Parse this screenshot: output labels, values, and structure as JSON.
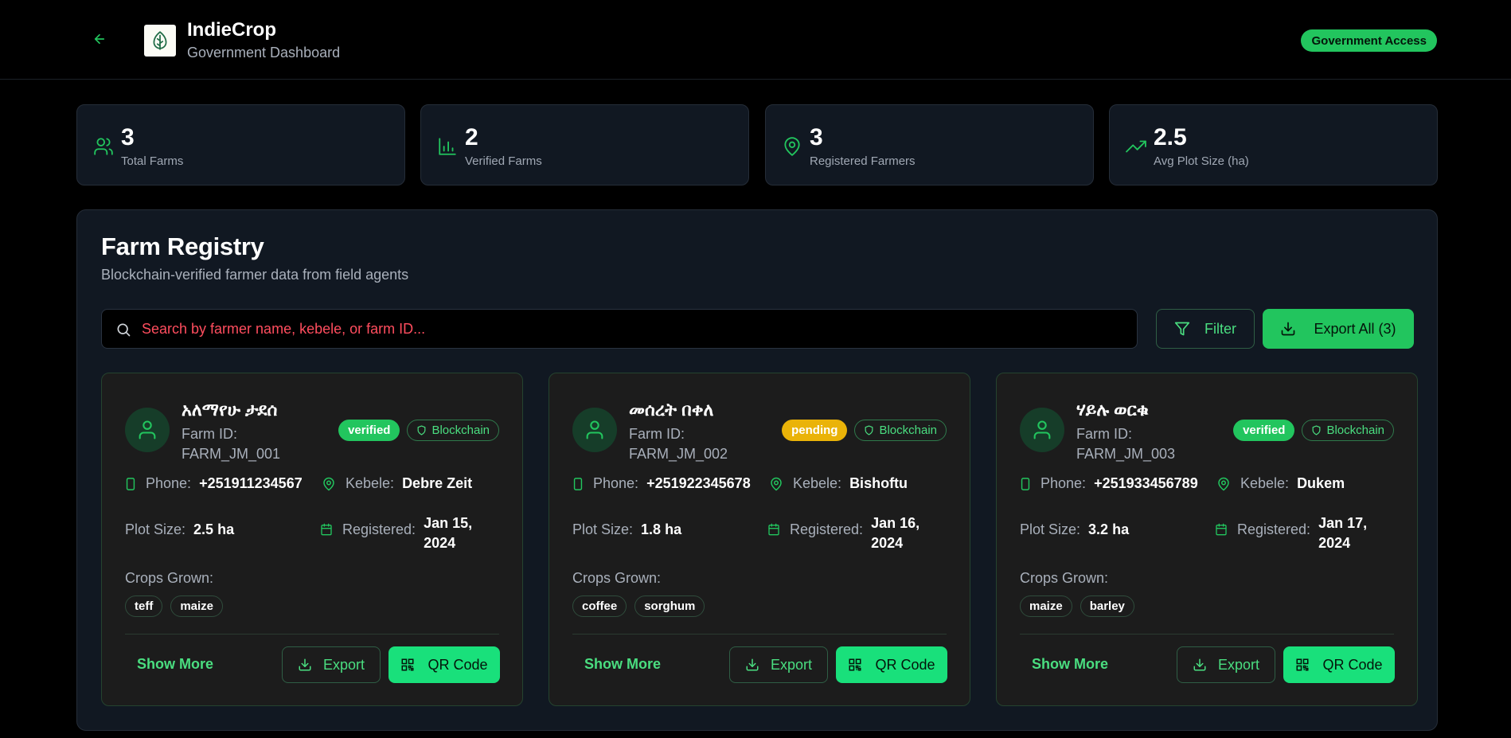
{
  "header": {
    "title": "IndieCrop",
    "subtitle": "Government Dashboard",
    "access_badge": "Government Access"
  },
  "stats": [
    {
      "value": "3",
      "label": "Total Farms",
      "icon": "users-icon"
    },
    {
      "value": "2",
      "label": "Verified Farms",
      "icon": "bar-chart-icon"
    },
    {
      "value": "3",
      "label": "Registered Farmers",
      "icon": "map-pin-icon"
    },
    {
      "value": "2.5",
      "label": "Avg Plot Size (ha)",
      "icon": "trending-up-icon"
    }
  ],
  "registry": {
    "title": "Farm Registry",
    "subtitle": "Blockchain-verified farmer data from field agents",
    "search_placeholder": "Search by farmer name, kebele, or farm ID...",
    "filter_label": "Filter",
    "export_all_label": "Export All (3)"
  },
  "labels": {
    "farm_id": "Farm ID:",
    "phone": "Phone:",
    "kebele": "Kebele:",
    "plot_size": "Plot Size:",
    "registered": "Registered:",
    "crops_grown": "Crops Grown:",
    "blockchain": "Blockchain",
    "show_more": "Show More",
    "export": "Export",
    "qr_code": "QR Code"
  },
  "farms": [
    {
      "name": "አለማየሁ ታደሰ",
      "farm_id": "FARM_JM_001",
      "status": "verified",
      "phone": "+251911234567",
      "kebele": "Debre Zeit",
      "plot_size": "2.5 ha",
      "registered_line1": "Jan 15,",
      "registered_line2": "2024",
      "crops": [
        "teff",
        "maize"
      ]
    },
    {
      "name": "መሰረት በቀለ",
      "farm_id": "FARM_JM_002",
      "status": "pending",
      "phone": "+251922345678",
      "kebele": "Bishoftu",
      "plot_size": "1.8 ha",
      "registered_line1": "Jan 16,",
      "registered_line2": "2024",
      "crops": [
        "coffee",
        "sorghum"
      ]
    },
    {
      "name": "ሃይሉ ወርቁ",
      "farm_id": "FARM_JM_003",
      "status": "verified",
      "phone": "+251933456789",
      "kebele": "Dukem",
      "plot_size": "3.2 ha",
      "registered_line1": "Jan 17,",
      "registered_line2": "2024",
      "crops": [
        "maize",
        "barley"
      ]
    }
  ],
  "colors": {
    "accent": "#22c55e",
    "accent_bright": "#19e07b",
    "pending": "#eab308",
    "search_placeholder": "#ff4d5e"
  }
}
